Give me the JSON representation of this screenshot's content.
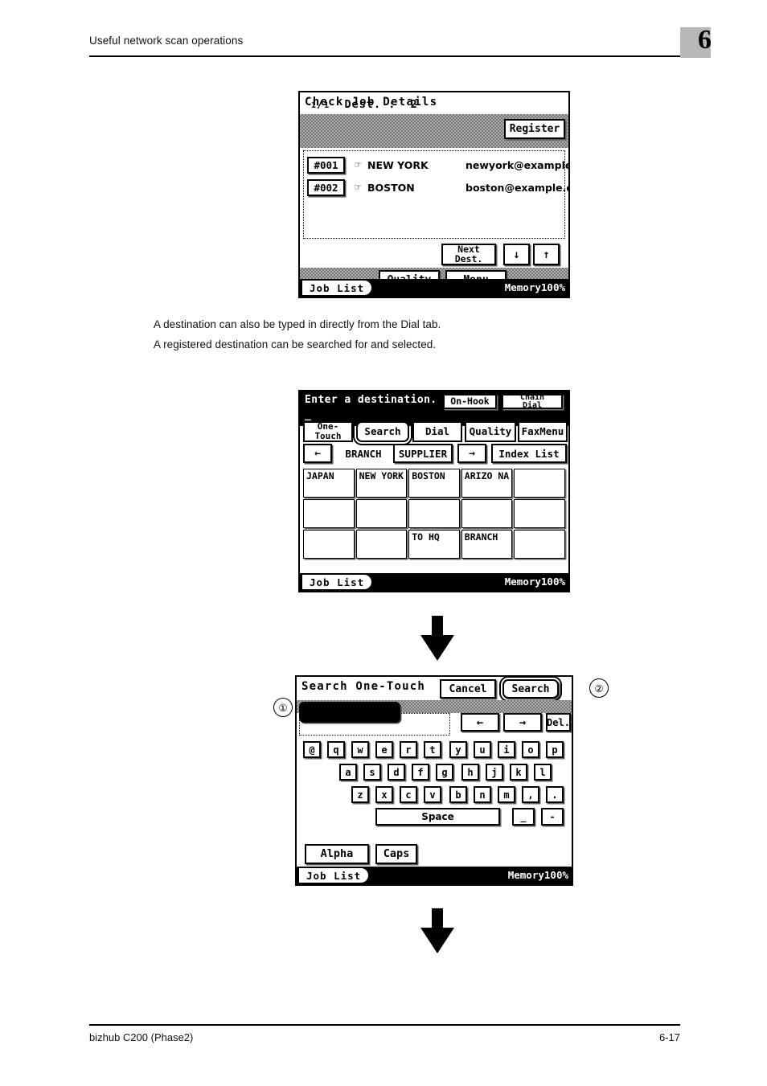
{
  "header": {
    "section_title": "Useful network scan operations",
    "chapter_number": "6"
  },
  "footer": {
    "product": "bizhub C200 (Phase2)",
    "page_number": "6-17"
  },
  "body": {
    "paragraph_1": "A destination can also be typed in directly from the Dial tab.",
    "paragraph_2": "A registered destination can be searched for and selected."
  },
  "callouts": {
    "one": "①",
    "two": "②"
  },
  "panel_check_job": {
    "title": "Check Job Details",
    "register_label": "Register",
    "destinations": [
      {
        "number": "#001",
        "icon": "hand-touch-icon",
        "name": "NEW YORK",
        "address": "newyork@example"
      },
      {
        "number": "#002",
        "icon": "hand-touch-icon",
        "name": "BOSTON",
        "address": "boston@example.c"
      }
    ],
    "page_current": "1",
    "page_total": "1",
    "dest_label": "Dest. :",
    "dest_count": "2",
    "next_dest_line1": "Next",
    "next_dest_line2": "Dest.",
    "scroll_down_icon": "↓",
    "scroll_up_icon": "↑",
    "quality_label": "Quality",
    "menu_label": "Menu",
    "job_list_label": "Job List",
    "memory_label": "Memory100%"
  },
  "panel_enter_destination": {
    "prompt": "Enter a destination.",
    "caret": "_",
    "on_hook_label": "On-Hook",
    "chain_dial_line1": "Chain",
    "chain_dial_line2": "Dial",
    "tabs": [
      {
        "label": "One-",
        "label2": "Touch",
        "selected": false
      },
      {
        "label": "Search",
        "selected": true
      },
      {
        "label": "Dial",
        "selected": false
      },
      {
        "label": "Quality",
        "selected": false
      },
      {
        "label": "FaxMenu",
        "selected": false
      }
    ],
    "index_prev_icon": "←",
    "index_next_icon": "→",
    "index_current": "BRANCH",
    "index_other": "SUPPLIER",
    "index_list_label": "Index List",
    "one_touch_keys": [
      "JAPAN",
      "NEW YORK",
      "BOSTON",
      "ARIZO NA",
      "",
      "",
      "",
      "",
      "",
      "",
      "",
      "",
      "TO HQ",
      "BRANCH",
      ""
    ],
    "job_list_label": "Job List",
    "memory_label": "Memory100%"
  },
  "panel_search_one_touch": {
    "title": "Search One-Touch",
    "cancel_label": "Cancel",
    "search_label": "Search",
    "input_value": "",
    "cursor_left_icon": "←",
    "cursor_right_icon": "→",
    "delete_label": "Del.",
    "keyboard_rows": [
      [
        "@",
        "q",
        "w",
        "e",
        "r",
        "t",
        "y",
        "u",
        "i",
        "o",
        "p"
      ],
      [
        "a",
        "s",
        "d",
        "f",
        "g",
        "h",
        "j",
        "k",
        "l"
      ],
      [
        "z",
        "x",
        "c",
        "v",
        "b",
        "n",
        "m",
        ",",
        "."
      ]
    ],
    "space_label": "Space",
    "underscore_key": "_",
    "hyphen_key": "-",
    "alpha_label": "Alpha",
    "caps_label": "Caps",
    "job_list_label": "Job List",
    "memory_label": "Memory100%"
  }
}
